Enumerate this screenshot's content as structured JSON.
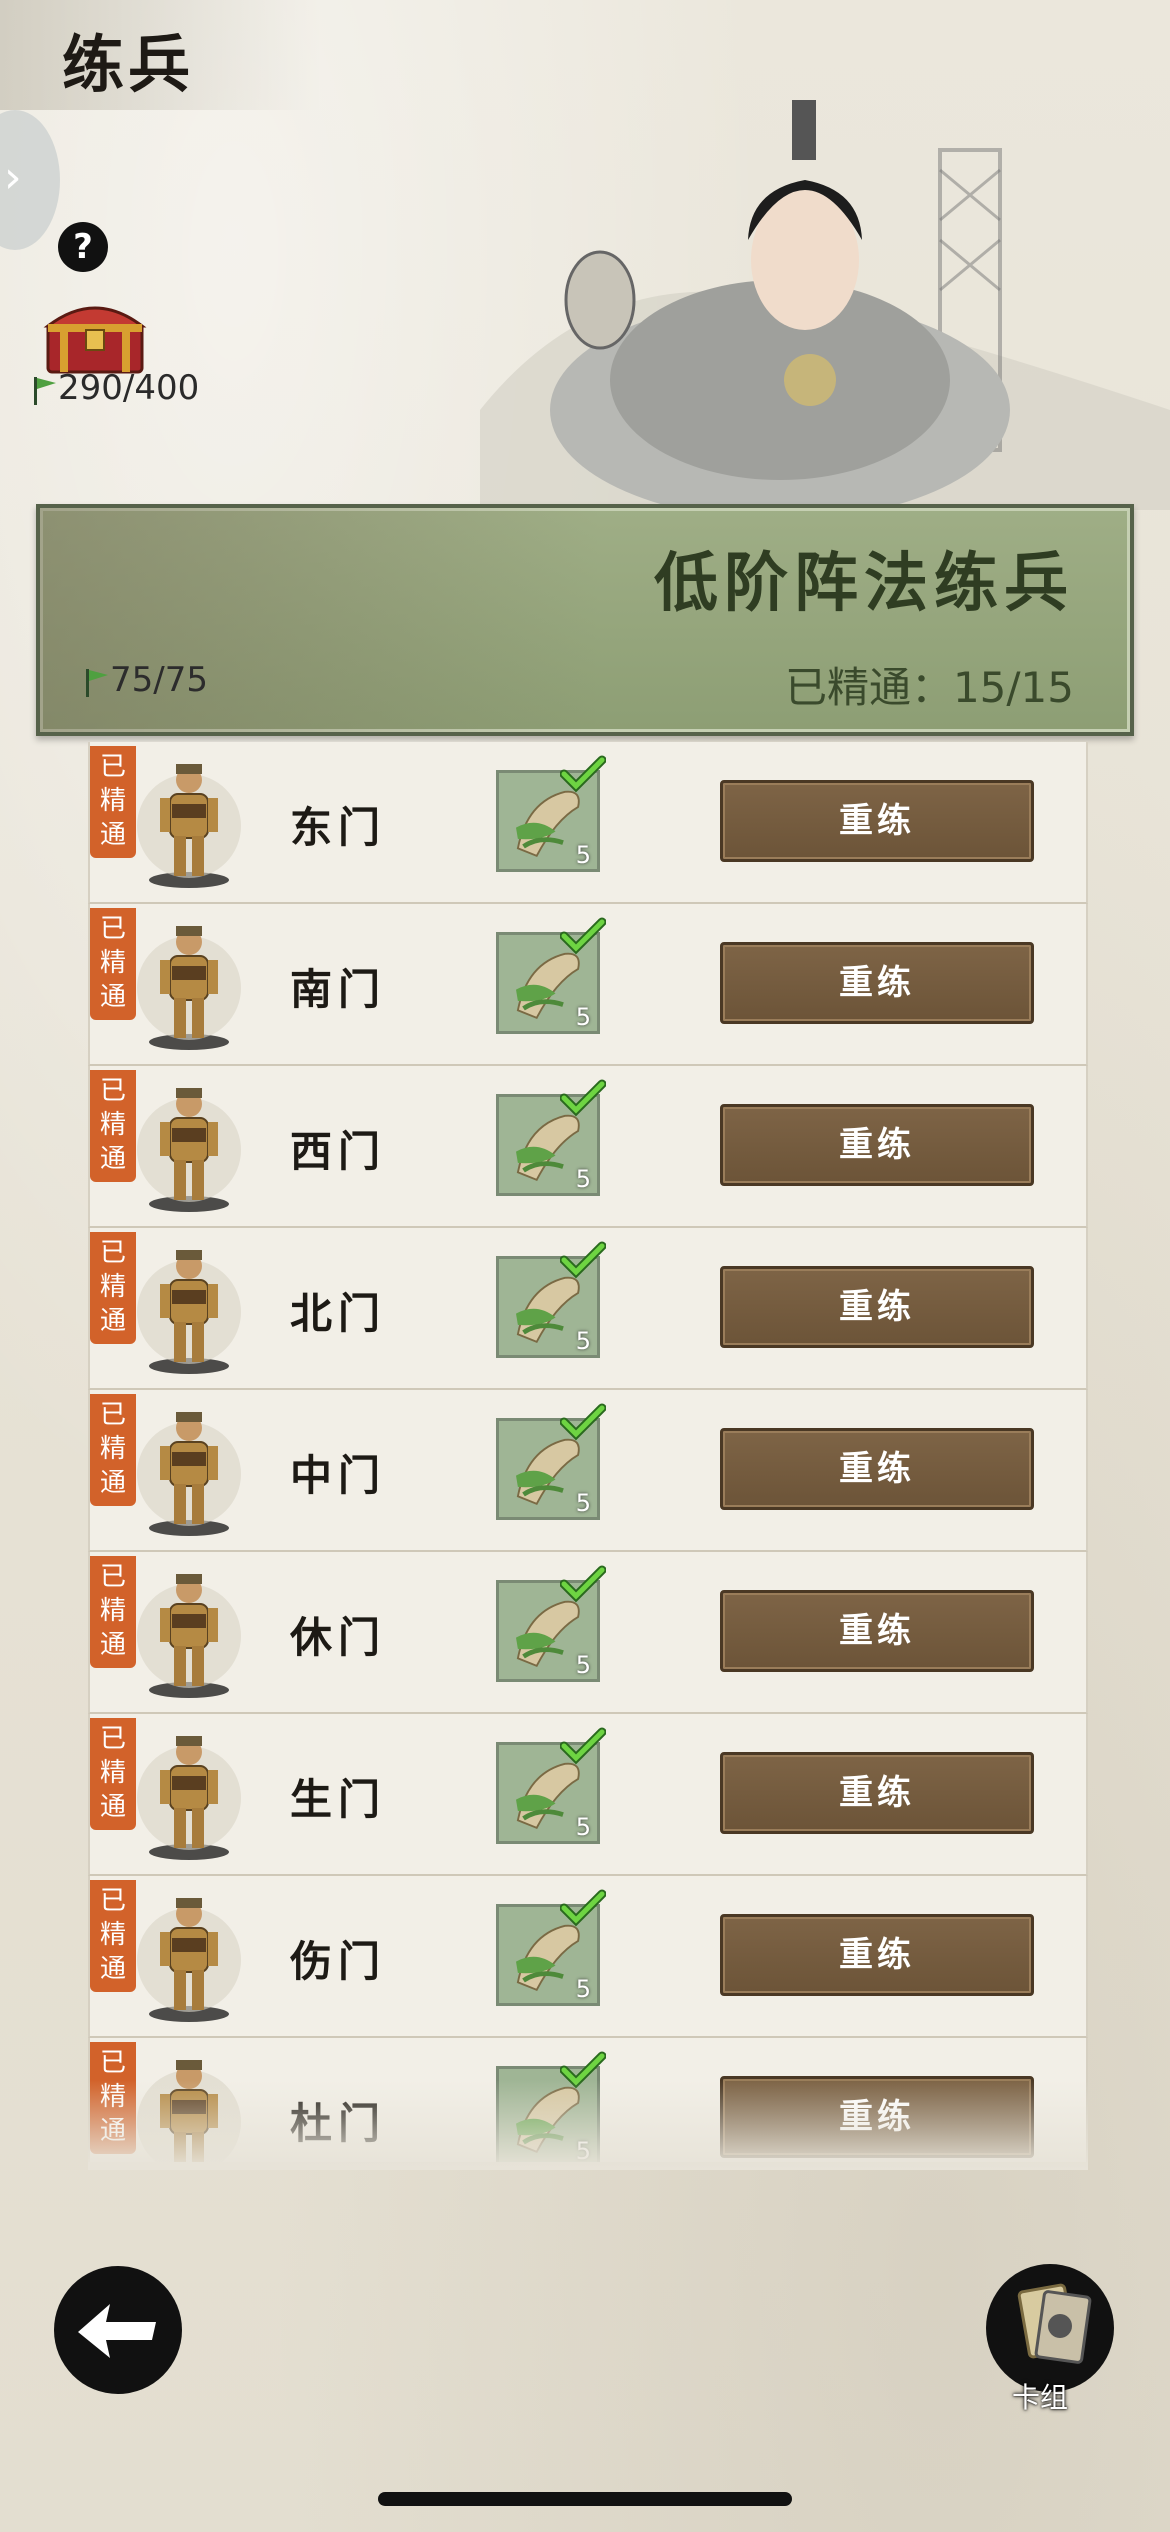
{
  "header": {
    "title": "练兵",
    "help_label": "?",
    "chest_count": "290/400"
  },
  "banner": {
    "title": "低阶阵法练兵",
    "flags": "75/75",
    "progress_label": "已精通：",
    "progress_value": "15/15"
  },
  "badge_text": [
    "已",
    "精",
    "通"
  ],
  "rows": [
    {
      "name": "东门",
      "qty": "5",
      "button": "重练"
    },
    {
      "name": "南门",
      "qty": "5",
      "button": "重练"
    },
    {
      "name": "西门",
      "qty": "5",
      "button": "重练"
    },
    {
      "name": "北门",
      "qty": "5",
      "button": "重练"
    },
    {
      "name": "中门",
      "qty": "5",
      "button": "重练"
    },
    {
      "name": "休门",
      "qty": "5",
      "button": "重练"
    },
    {
      "name": "生门",
      "qty": "5",
      "button": "重练"
    },
    {
      "name": "伤门",
      "qty": "5",
      "button": "重练"
    },
    {
      "name": "杜门",
      "qty": "5",
      "button": "重练"
    }
  ],
  "footer": {
    "deck_label": "卡组"
  },
  "colors": {
    "badge": "#d2622a",
    "banner": "#9fae86",
    "button": "#7e6446"
  }
}
